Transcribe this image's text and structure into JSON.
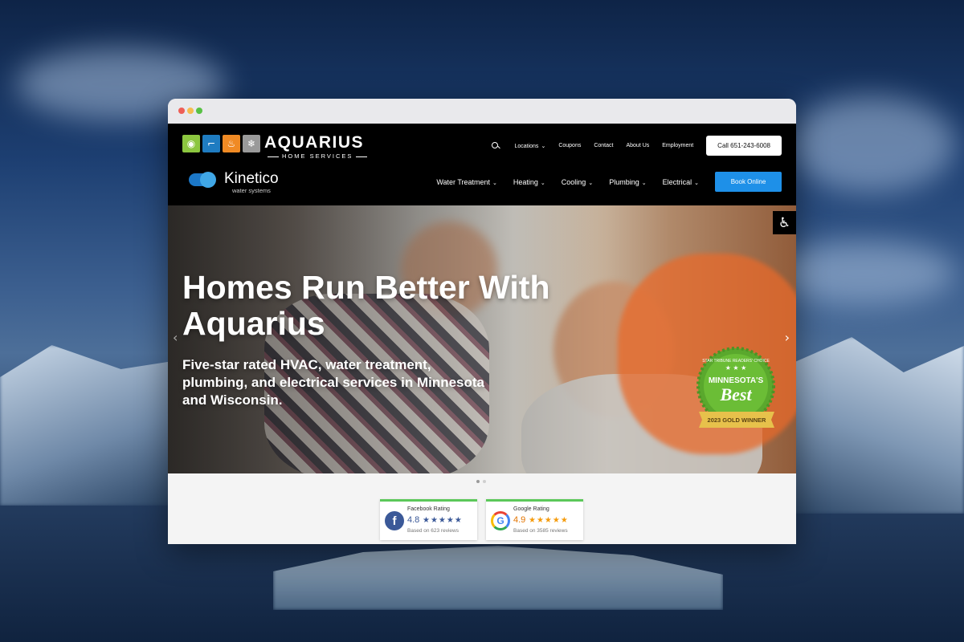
{
  "brand": {
    "name": "AQUARIUS",
    "sub": "HOME SERVICES",
    "partner_name": "Kinetico",
    "partner_sub": "water systems"
  },
  "top_nav": {
    "items": [
      "Locations",
      "Coupons",
      "Contact",
      "About Us",
      "Employment"
    ],
    "call_label": "Call 651-243-6008"
  },
  "main_nav": {
    "items": [
      "Water Treatment",
      "Heating",
      "Cooling",
      "Plumbing",
      "Electrical"
    ],
    "book_label": "Book Online"
  },
  "hero": {
    "title": "Homes Run Better With Aquarius",
    "subtitle": "Five-star rated HVAC, water treatment, plumbing, and electrical services in Minnesota and Wisconsin."
  },
  "badge": {
    "top_text": "STAR TRIBUNE READERS' CHOICE",
    "line1": "MINNESOTA'S",
    "line2": "Best",
    "ribbon": "2023 GOLD WINNER"
  },
  "carousel": {
    "slide_count": 2,
    "active_index": 0
  },
  "ratings": {
    "facebook": {
      "title": "Facebook Rating",
      "score": "4.8",
      "stars": "★★★★★",
      "based": "Based on 623 reviews"
    },
    "google": {
      "title": "Google Rating",
      "score": "4.9",
      "stars": "★★★★★",
      "based": "Based on 3585 reviews"
    }
  },
  "colors": {
    "book_button": "#1e90e8",
    "badge_green": "#5aa82d",
    "badge_gold": "#e7c14b",
    "rating_accent": "#5cc85a"
  }
}
